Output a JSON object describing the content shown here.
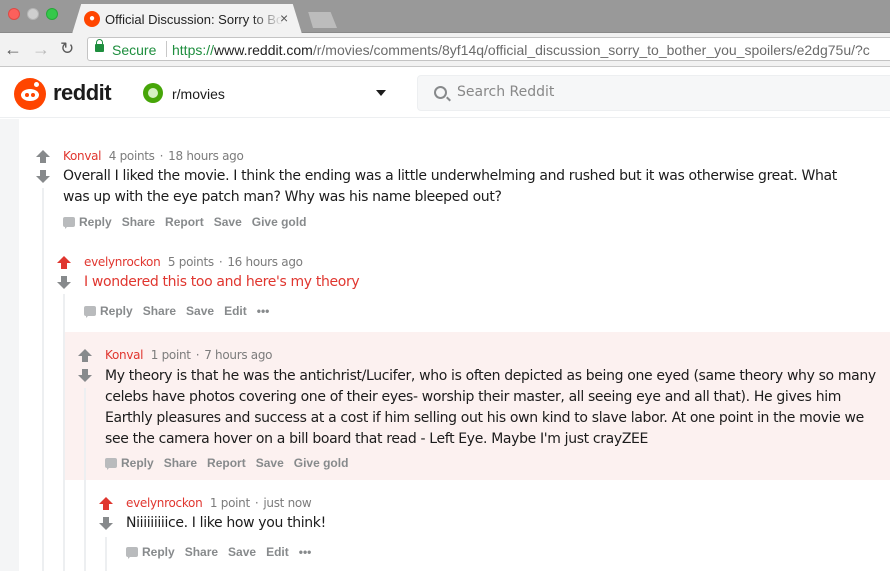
{
  "browser": {
    "tab": {
      "title": "Official Discussion: Sorry to Bother You",
      "close": "×"
    },
    "nav": {
      "back": "←",
      "forward": "→",
      "reload": "C"
    },
    "address": {
      "secure_label": "Secure",
      "scheme": "https://",
      "host": "www.reddit.com",
      "path": "/r/movies/comments/8yf14q/official_discussion_sorry_to_bother_you_spoilers/e2dg75u/?c"
    }
  },
  "header": {
    "brand": "reddit",
    "subreddit": "r/movies",
    "search_placeholder": "Search Reddit"
  },
  "colors": {
    "accent": "#ff4500",
    "author": "#e0362f",
    "upvoted": "#e0362f",
    "highlight_bg": "#fcf1f0"
  },
  "comments": [
    {
      "author": "Konval",
      "points": "4 points",
      "time": "18 hours ago",
      "body": "Overall I liked the movie. I think the ending was a little underwhelming and rushed but it was otherwise great. What was up with the eye patch man? Why was his name bleeped out?",
      "actions": [
        "Reply",
        "Share",
        "Report",
        "Save",
        "Give gold"
      ],
      "upvoted": false
    },
    {
      "author": "evelynrockon",
      "points": "5 points",
      "time": "16 hours ago",
      "body": "I wondered this too and here's my theory",
      "actions": [
        "Reply",
        "Share",
        "Save",
        "Edit",
        "•••"
      ],
      "upvoted": true
    },
    {
      "author": "Konval",
      "points": "1 point",
      "time": "7 hours ago",
      "body": "My theory is that he was the antichrist/Lucifer, who is often depicted as being one eyed (same theory why so many celebs have photos covering one of their eyes- worship their master, all seeing eye and all that). He gives him Earthly pleasures and success at a cost if him selling out his own kind to slave labor. At one point in the movie we see the camera hover on a bill board that read - Left Eye. Maybe I'm just crayZEE",
      "actions": [
        "Reply",
        "Share",
        "Report",
        "Save",
        "Give gold"
      ],
      "upvoted": false,
      "highlighted": true
    },
    {
      "author": "evelynrockon",
      "points": "1 point",
      "time": "just now",
      "body": "Niiiiiiiiice. I like how you think!",
      "actions": [
        "Reply",
        "Share",
        "Save",
        "Edit",
        "•••"
      ],
      "upvoted": true
    }
  ]
}
